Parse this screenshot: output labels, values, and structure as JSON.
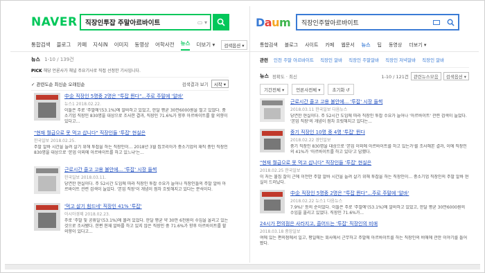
{
  "naver": {
    "logo": "NAVER",
    "query": "직장인투잡 주말아르바이트",
    "kbd_hint": "▭ ▾",
    "tabs": [
      "통합검색",
      "블로그",
      "카페",
      "지식iN",
      "이미지",
      "동영상",
      "어학사전",
      "뉴스",
      "더보기 ▾"
    ],
    "active_tab": "뉴스",
    "options_label": "검색옵션 ▾",
    "section_title": "뉴스",
    "section_count": "1-10 / 139건",
    "pick_prefix": "PICK",
    "pick_text": "해당 언론사가 채널 주요기사로 직접 선정한 기사입니다.",
    "bar_left": "✓ 관련도순   최신순   오래된순",
    "bar_right": "검색결과 보기",
    "bar_box": "시작 ▾",
    "results": [
      {
        "title": "中企 직장인 5명중 2명은 \"투잡 뛴다\"...주로 주말에 '알바'",
        "meta": "뉴스1  2018.02.22.",
        "summary": "이들은 주로 '주말에'(53.1%)에 알바하고 있었고, 한달 평균 30만6000원을 벌고 있었다. 중소기업 직장인 830명을 대상으로 조사한 결과, 직장인 71.6%가 향후 아르바이트를 할 의향이 있다고..."
      },
      {
        "title": "\"현재 월급으로 못 먹고 삽니다\" 직장인들 '투잡' 현실은",
        "meta": "한국일보  2018.02.25.",
        "summary": "주말 알바 시간을 늘려 살기 위해 투잡을 하는 직장인이... 2018년 3월 집코리아가 중소기업의 재직 중인 직장인 830명을 대상으로 '본업 이외에 아르바이트를 하고 있느냐'는..."
      },
      {
        "title": "근로시간 줄고 고용 불안에... '투잡' 시장 들썩",
        "meta": "한국일보  2018.03.11.",
        "summary": "당연한 현실이다. 주 52시간 도입에 따라 직장인 투잡 수요가 늘어나 직장인들의 주말 알바 아르바이트 관련 검색이 늘었다. '본업 직장'이 개념이 점차 흐릿해지고 있다는 분석이다."
      },
      {
        "title": "'먹고 살기 힘드네' 직장인 41% '투잡'",
        "meta": "아시아경제  2018.02.23.",
        "summary": "주로 '주말 및 공휴일'(53.1%)에 몰려 있었다. 한달 평균 약 30만 6천원의 수입을 올리고 있는 것으로 조사됐다. 한편 현재 알바를 하고 있지 않은 직장인 중 71.6%가 향후 아르바이트를 할 의향이 있다고..."
      }
    ]
  },
  "daum": {
    "logo_parts": [
      "D",
      "a",
      "u",
      "m"
    ],
    "logo_colors": [
      "#3a7bd5",
      "#e8413b",
      "#f5a623",
      "#3cb44b"
    ],
    "query": "직장인주말아르바이트",
    "tabs": [
      "통합검색",
      "블로그",
      "사이트",
      "카페",
      "웹문서",
      "뉴스",
      "팁",
      "동영상",
      "더보기 ▾"
    ],
    "active_tab": "뉴스",
    "related_label": "관련",
    "related": [
      "인천 주말 아르바이트",
      "직장인 알바",
      "직장인 주말알바",
      "직장인 저녁알바",
      "직장인 알바"
    ],
    "section_title": "뉴스",
    "sort_text": "정확도 · 최신",
    "count_text": "1-10 / 121건",
    "btn_related": "관련뉴스모음",
    "btn_options": "검색옵션 ▾",
    "filters": [
      "기간전체 ▾",
      "언론사전체 ▾",
      "초기화 ↺"
    ],
    "results": [
      {
        "title": "근로시간 줄고 고용 불안에... '투잡' 시장 들썩",
        "meta": "2018.03.11  한국일보  다음뉴스",
        "summary": "당연한 현실이다. 주 52시간 도입에 따라 직장인 투잡 수요가 늘어나 '아르바이트' 관련 검색이 늘었다. '본업 직장'의 개념이 점차 흐릿해지고 있다는..."
      },
      {
        "title": "중기 직장인 10명 중 4명 '투잡' 뛴다",
        "meta": "2018.02.22  경인일보",
        "summary": "중기 직장인 830명을 대상으로 '본업 이외에 아르바이트를 하고 있는가'를 조사해본 결과, 이에 직장인의 41%가 '아르바이트를 하고 있다'고 답했다."
      },
      {
        "title": "\"현재 월급으로 못 먹고 삽니다\" 직장인들 '투잡' 현실은",
        "meta": "2018.02.25  한국일보",
        "summary": "이 처는 불집 잘이 근에 이전만 주말 알바 시간을 늘려 살기 위해 투잡을 하는 직장인이... 중소기업 직장인의 주말 알바 현실이 드러났다."
      },
      {
        "title": "中企 직장인 5명중 2명은 \"투잡 뛴다\"...주로 주말에 '알바'",
        "meta": "2018.02.22  뉴스1  다음뉴스",
        "summary": "7.9%)' 등의 순이었다. 이들은 주로 '주말에'(53.1%)에 알바하고 있었고, 한달 평균 30만6000원의 수입을 올리고 있었다. 직장인 71.6%가..."
      },
      {
        "title": "24시가 편의점은 사라지고, 즐어드는 '투잡' 직장인의 비애",
        "meta": "2018.03.18  중앙일보",
        "summary": "여에 있는 편의점에서 일고, 평일에는 회사에서 근무하고 주말에 아르바이트를 하는 직장인의 비애에 관한 이야기를 들어봤다."
      }
    ],
    "more_label": "다음뉴스"
  }
}
